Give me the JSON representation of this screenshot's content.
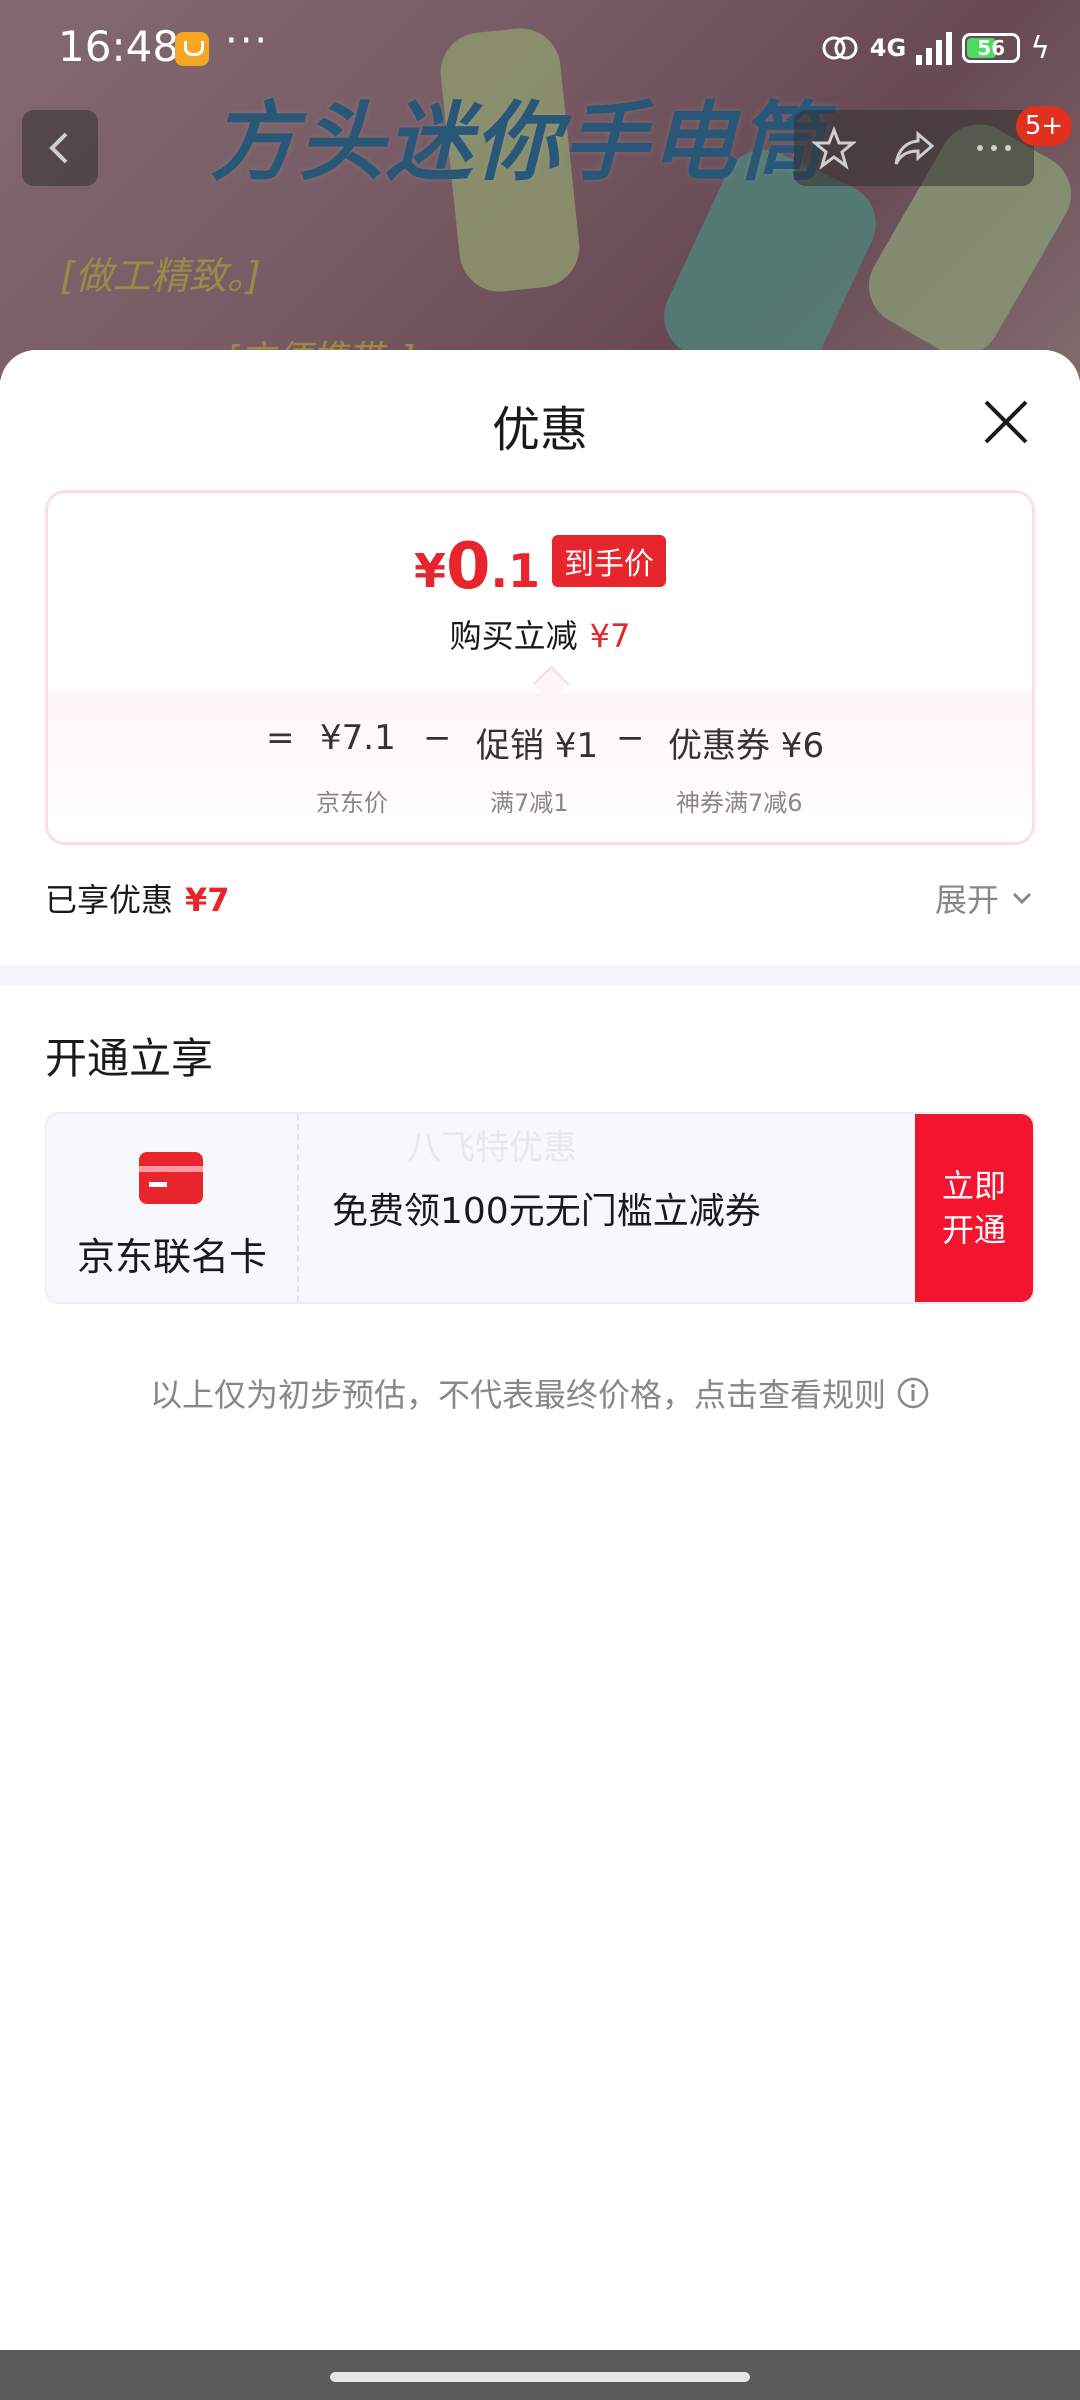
{
  "status_bar": {
    "time": "16:48",
    "more": "···",
    "network": "4G",
    "battery": "56"
  },
  "background": {
    "product_title": "方头迷你手电筒",
    "tagline_1": "[做工精致。]",
    "tagline_2": "[方便携带。]",
    "cart_badge": "5+"
  },
  "sheet": {
    "title": "优惠",
    "price": {
      "symbol": "¥",
      "integer": "0",
      "decimal": ".1",
      "badge": "到手价",
      "instant_cut_label": "购买立减",
      "instant_cut_amount": "¥7"
    },
    "calc": {
      "equals": "=",
      "jd_price": "¥7.1",
      "jd_price_label": "京东价",
      "minus1": "−",
      "promo": "促销 ¥1",
      "promo_label": "满7减1",
      "minus2": "−",
      "coupon": "优惠券 ¥6",
      "coupon_label": "神券满7减6"
    },
    "applied": {
      "label": "已享优惠",
      "amount": "¥7"
    },
    "expand_label": "展开",
    "open_section": {
      "title": "开通立享",
      "card_name": "京东联名卡",
      "watermark": "八飞特优惠",
      "desc": "免费领100元无门槛立减券",
      "cta": "立即开通"
    },
    "disclaimer": "以上仅为初步预估，不代表最终价格，点击查看规则"
  },
  "colors": {
    "accent": "#e8242c",
    "cta": "#f5142f",
    "muted": "#888888"
  }
}
